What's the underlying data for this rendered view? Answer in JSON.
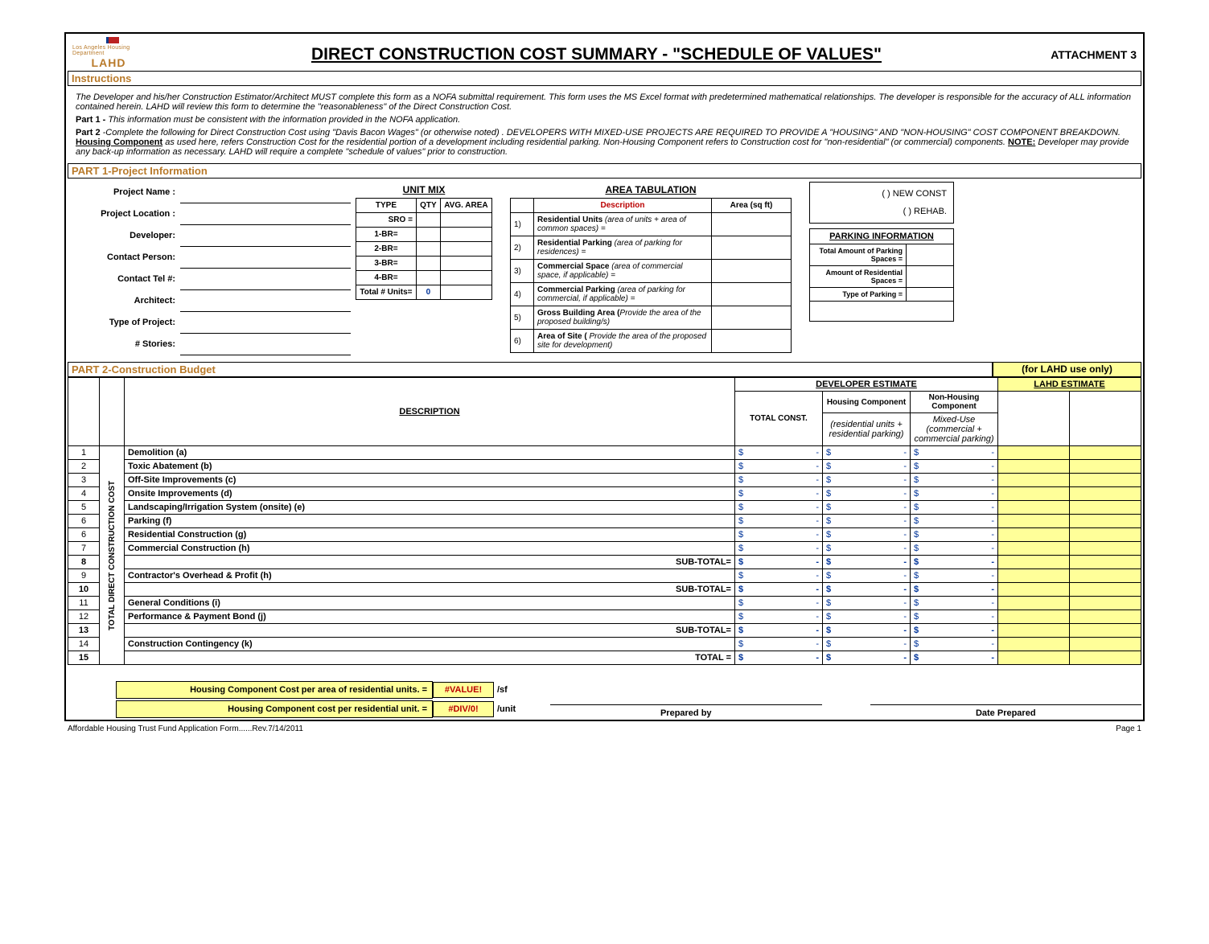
{
  "header": {
    "attachment": "ATTACHMENT 3",
    "brand_sub": "Los Angeles Housing Department",
    "brand": "LAHD",
    "title": "DIRECT CONSTRUCTION COST SUMMARY - \"SCHEDULE OF VALUES\""
  },
  "instructions": {
    "heading": "Instructions",
    "p1": "The Developer and his/her Construction Estimator/Architect MUST complete this form as a NOFA submittal requirement. This form uses the MS Excel format with predetermined mathematical relationships.  The developer is responsible for the accuracy of ALL information contained herein.  LAHD will review this form to determine the \"reasonableness\" of the Direct Construction Cost.",
    "p2_lead": "Part 1 -",
    "p2": "This information must be consistent with the information provided in the NOFA application.",
    "p3_lead": "Part 2",
    "p3a": " -Complete the following for Direct Construction Cost using \"Davis Bacon Wages\" (or otherwise noted) . DEVELOPERS WITH MIXED-USE PROJECTS ARE REQUIRED TO PROVIDE A \"HOUSING\" AND \"NON-HOUSING\" COST COMPONENT BREAKDOWN.  ",
    "p3_hc": "Housing Component",
    "p3b": " as used here, refers Construction Cost for the residential portion of a development including residential parking. Non-Housing Component refers to Construction cost for \"non-residential\" (or commercial) components.  ",
    "p3_note": "NOTE:",
    "p3c": " Developer may provide any back-up information as necessary.  LAHD will require a complete \"schedule of values\" prior to construction."
  },
  "part1": {
    "heading": "PART 1-Project Information",
    "labels": {
      "project_name": "Project Name :",
      "project_location": "Project Location :",
      "developer": "Developer:",
      "contact_person": "Contact Person:",
      "contact_tel": "Contact Tel #:",
      "architect": "Architect:",
      "type_of_project": "Type of Project:",
      "stories": "# Stories:"
    },
    "unit_mix": {
      "heading": "UNIT MIX",
      "cols": {
        "type": "TYPE",
        "qty": "QTY",
        "avg": "AVG. AREA"
      },
      "rows": [
        {
          "type": "SRO ="
        },
        {
          "type": "1-BR="
        },
        {
          "type": "2-BR="
        },
        {
          "type": "3-BR="
        },
        {
          "type": "4-BR="
        }
      ],
      "total_label": "Total # Units=",
      "total_value": "0"
    },
    "area_tab": {
      "heading": "AREA TABULATION",
      "desc_h": "Description",
      "area_h": "Area (sq ft)",
      "rows": [
        {
          "n": "1)",
          "b": "Residential Units",
          "i": "  (area of units + area of common spaces) ="
        },
        {
          "n": "2)",
          "b": "Residential Parking",
          "i": " (area of parking for residences) ="
        },
        {
          "n": "3)",
          "b": "Commercial Space",
          "i": " (area of commercial space, if applicable) ="
        },
        {
          "n": "4)",
          "b": "Commercial Parking",
          "i": " (area of parking for commercial, if applicable) ="
        },
        {
          "n": "5)",
          "b": "Gross Building Area (",
          "i": "Provide the area of the proposed building/s)"
        },
        {
          "n": "6)",
          "b": "Area of Site (",
          "i": " Provide the area of the proposed site for development)"
        }
      ]
    },
    "const_type": {
      "new": "(    ) NEW CONST",
      "rehab": "(    ) REHAB."
    },
    "parking": {
      "heading": "PARKING INFORMATION",
      "rows": [
        {
          "l": "Total Amount of Parking Spaces ="
        },
        {
          "l": "Amount of Residential Spaces ="
        },
        {
          "l": "Type of Parking ="
        }
      ]
    }
  },
  "part2": {
    "heading_left": "PART 2-Construction Budget",
    "heading_right": "(for LAHD use only)",
    "cols": {
      "description": "DESCRIPTION",
      "dev_est": "DEVELOPER ESTIMATE",
      "lahd_est": "LAHD ESTIMATE",
      "total": "TOTAL CONST.",
      "housing": "Housing Component",
      "nonhousing": "Non-Housing Component",
      "housing_note": "(residential units + residential parking)",
      "nonhousing_note": "Mixed-Use (commercial + commercial parking)"
    },
    "vert_label": "TOTAL DIRECT CONSTRUCTION COST",
    "rows": [
      {
        "n": "1",
        "d": "Demolition (a)"
      },
      {
        "n": "2",
        "d": "Toxic Abatement (b)"
      },
      {
        "n": "3",
        "d": "Off-Site Improvements (c)"
      },
      {
        "n": "4",
        "d": "Onsite Improvements (d)"
      },
      {
        "n": "5",
        "d": "Landscaping/Irrigation System (onsite) (e)"
      },
      {
        "n": "6",
        "d": "Parking (f)"
      },
      {
        "n": "6",
        "d": "Residential Construction (g)"
      },
      {
        "n": "7",
        "d": "Commercial Construction (h)"
      },
      {
        "n": "8",
        "d": "SUB-TOTAL=",
        "sub": true
      },
      {
        "n": "9",
        "d": "Contractor's Overhead & Profit (h)"
      },
      {
        "n": "10",
        "d": "SUB-TOTAL=",
        "sub": true
      },
      {
        "n": "11",
        "d": "General Conditions (i)"
      },
      {
        "n": "12",
        "d": "Performance & Payment Bond (j)"
      },
      {
        "n": "13",
        "d": "SUB-TOTAL=",
        "sub": true
      },
      {
        "n": "14",
        "d": "Construction Contingency (k)"
      },
      {
        "n": "15",
        "d": "TOTAL =",
        "sub": true
      }
    ],
    "dollar": "$",
    "dash": "-"
  },
  "calc": {
    "l1": "Housing Component Cost per area of residential units. =",
    "v1": "#VALUE!",
    "u1": "/sf",
    "l2": "Housing Component cost per residential unit. =",
    "v2": "#DIV/0!",
    "u2": "/unit"
  },
  "sig": {
    "prepared_by": "Prepared by",
    "date_prepared": "Date Prepared"
  },
  "footer": {
    "left": "Affordable Housing Trust Fund Application Form......Rev.7/14/2011",
    "right": "Page 1"
  }
}
